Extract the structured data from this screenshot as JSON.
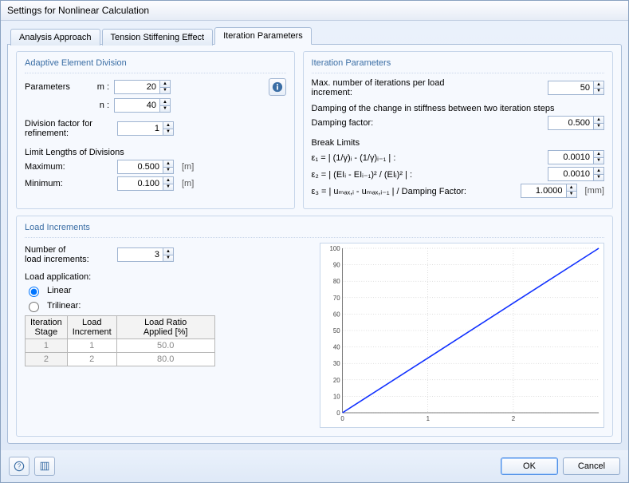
{
  "window": {
    "title": "Settings for Nonlinear Calculation"
  },
  "tabs": {
    "analysis": "Analysis Approach",
    "tension": "Tension Stiffening Effect",
    "iteration": "Iteration Parameters"
  },
  "adaptive": {
    "title": "Adaptive Element Division",
    "parameters_label": "Parameters",
    "m_label": "m :",
    "m_value": "20",
    "n_label": "n :",
    "n_value": "40",
    "division_factor_label": "Division factor for\nrefinement:",
    "division_factor_value": "1",
    "limit_title": "Limit Lengths of Divisions",
    "max_label": "Maximum:",
    "max_value": "0.500",
    "max_unit": "[m]",
    "min_label": "Minimum:",
    "min_value": "0.100",
    "min_unit": "[m]"
  },
  "iter": {
    "title": "Iteration Parameters",
    "maxiter_label": "Max. number of iterations per load\nincrement:",
    "maxiter_value": "50",
    "damping_desc": "Damping of the change in stiffness between two iteration steps",
    "damping_label": "Damping factor:",
    "damping_value": "0.500",
    "break_title": "Break Limits",
    "e1_label": "ε₁ = | (1/γ)ᵢ - (1/γ)ᵢ₋₁ | :",
    "e1_value": "0.0010",
    "e2_label": "ε₂ = | (EIᵢ - EIᵢ₋₁)² / (EIᵢ)² | :",
    "e2_value": "0.0010",
    "e3_label": "ε₃ = | uₘₐₓ,ᵢ - uₘₐₓ,ᵢ₋₁ | / Damping Factor:",
    "e3_value": "1.0000",
    "e3_unit": "[mm]"
  },
  "load": {
    "title": "Load Increments",
    "num_label": "Number of\nload increments:",
    "num_value": "3",
    "app_label": "Load application:",
    "linear": "Linear",
    "trilinear": "Trilinear:",
    "table": {
      "col1": "Iteration\nStage",
      "col2": "Load\nIncrement",
      "col3": "Load Ratio\nApplied [%]",
      "rows": [
        {
          "stage": "1",
          "inc": "1",
          "ratio": "50.0"
        },
        {
          "stage": "2",
          "inc": "2",
          "ratio": "80.0"
        }
      ]
    }
  },
  "buttons": {
    "ok": "OK",
    "cancel": "Cancel"
  },
  "chart_data": {
    "type": "line",
    "x": [
      0,
      1,
      2,
      3
    ],
    "series": [
      {
        "name": "Load Ratio",
        "values": [
          0,
          33.3,
          66.7,
          100
        ]
      }
    ],
    "xlabel": "",
    "ylabel": "",
    "xlim": [
      0,
      3
    ],
    "ylim": [
      0,
      100
    ],
    "xticks": [
      0,
      1,
      2
    ],
    "yticks": [
      0,
      10,
      20,
      30,
      40,
      50,
      60,
      70,
      80,
      90,
      100
    ],
    "grid": true,
    "line_color": "#1030ff"
  }
}
